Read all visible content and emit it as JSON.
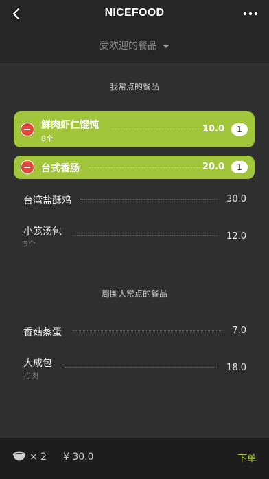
{
  "header": {
    "title": "NICEFOOD",
    "back_icon": "chevron-left-icon",
    "more_icon": "more-dots-icon"
  },
  "filter": {
    "label": "受欢迎的餐品"
  },
  "sections": [
    {
      "title": "我常点的餐品",
      "items": [
        {
          "name": "鲜肉虾仁馄饨",
          "sub": "8个",
          "price": "10.0",
          "qty": "1"
        },
        {
          "name": "台式香肠",
          "sub": "",
          "price": "20.0",
          "qty": "1"
        },
        {
          "name": "台湾盐酥鸡",
          "sub": "",
          "price": "30.0"
        },
        {
          "name": "小笼汤包",
          "sub": "5个",
          "price": "12.0"
        }
      ]
    },
    {
      "title": "周围人常点的餐品",
      "items": [
        {
          "name": "香菇蒸蛋",
          "sub": "",
          "price": "7.0"
        },
        {
          "name": "大成包",
          "sub": "扣肉",
          "price": "18.0"
        }
      ]
    }
  ],
  "footer": {
    "count": "× 2",
    "total": "¥ 30.0",
    "order_label": "下单"
  },
  "colors": {
    "accent": "#a3c53b",
    "remove": "#e2483b",
    "background": "#2f2f2f"
  }
}
